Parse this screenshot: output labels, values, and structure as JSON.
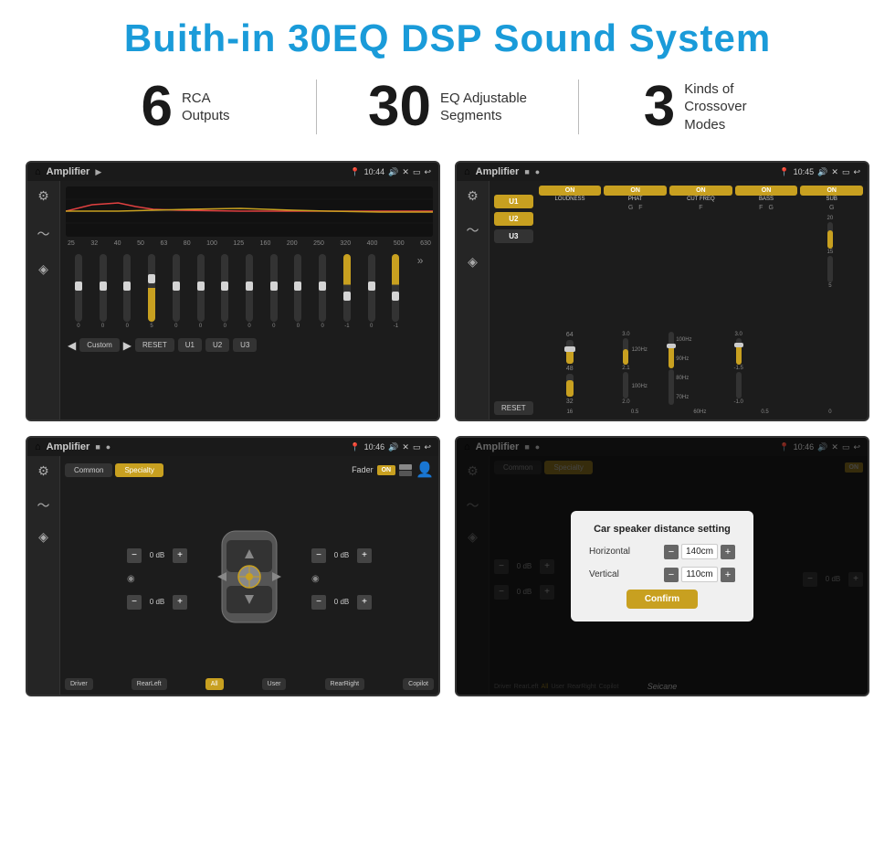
{
  "page": {
    "title": "Buith-in 30EQ DSP Sound System",
    "stats": [
      {
        "number": "6",
        "label": "RCA\nOutputs"
      },
      {
        "number": "30",
        "label": "EQ Adjustable\nSegments"
      },
      {
        "number": "3",
        "label": "Kinds of\nCrossover Modes"
      }
    ]
  },
  "screen1": {
    "title": "Amplifier",
    "time": "10:44",
    "freqs": [
      "25",
      "32",
      "40",
      "50",
      "63",
      "80",
      "100",
      "125",
      "160",
      "200",
      "250",
      "320",
      "400",
      "500",
      "630"
    ],
    "values": [
      "0",
      "0",
      "0",
      "5",
      "0",
      "0",
      "0",
      "0",
      "0",
      "0",
      "0",
      "-1",
      "0",
      "-1"
    ],
    "bottomBtns": [
      "RESET",
      "U1",
      "U2",
      "U3"
    ],
    "customLabel": "Custom"
  },
  "screen2": {
    "title": "Amplifier",
    "time": "10:45",
    "onButtons": [
      "LOUDNESS",
      "PHAT",
      "CUT FREQ",
      "BASS",
      "SUB"
    ],
    "uButtons": [
      "U1",
      "U2",
      "U3"
    ],
    "resetLabel": "RESET"
  },
  "screen3": {
    "title": "Amplifier",
    "time": "10:46",
    "tabs": [
      "Common",
      "Specialty"
    ],
    "faderLabel": "Fader",
    "zoneButtons": [
      "Driver",
      "RearLeft",
      "All",
      "User",
      "RearRight",
      "Copilot"
    ],
    "dbValues": [
      "0 dB",
      "0 dB",
      "0 dB",
      "0 dB"
    ]
  },
  "screen4": {
    "title": "Amplifier",
    "time": "10:46",
    "tabs": [
      "Common",
      "Specialty"
    ],
    "modal": {
      "title": "Car speaker distance setting",
      "fields": [
        {
          "label": "Horizontal",
          "value": "140cm"
        },
        {
          "label": "Vertical",
          "value": "110cm"
        }
      ],
      "confirmLabel": "Confirm",
      "dbValues": [
        "0 dB",
        "0 dB"
      ]
    },
    "zoneButtons": [
      "Driver",
      "RearLeft",
      "All",
      "User",
      "RearRight",
      "Copilot"
    ]
  },
  "watermark": "Seicane"
}
